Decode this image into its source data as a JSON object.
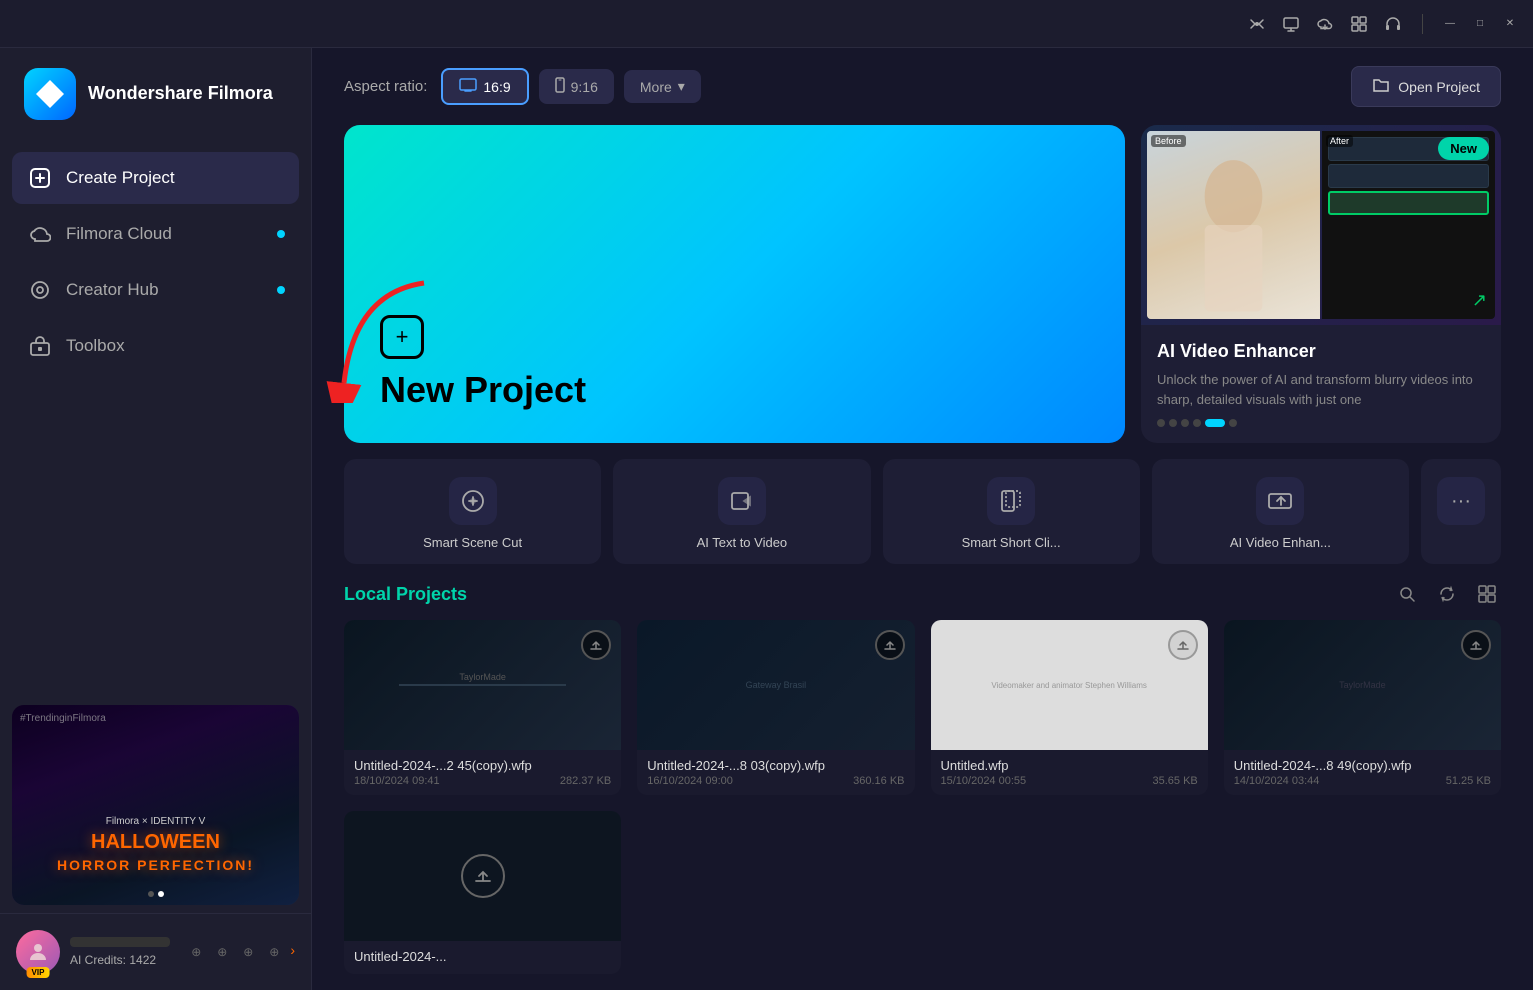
{
  "app": {
    "name": "Wondershare Filmora"
  },
  "titlebar": {
    "icons": [
      "broadcast",
      "screen",
      "download",
      "grid",
      "headphones"
    ],
    "minimize": "—",
    "maximize": "□",
    "close": "✕"
  },
  "sidebar": {
    "nav_items": [
      {
        "id": "create-project",
        "label": "Create Project",
        "icon": "➕",
        "active": true,
        "dot": false
      },
      {
        "id": "filmora-cloud",
        "label": "Filmora Cloud",
        "icon": "☁",
        "active": false,
        "dot": true
      },
      {
        "id": "creator-hub",
        "label": "Creator Hub",
        "icon": "◎",
        "active": false,
        "dot": true
      },
      {
        "id": "toolbox",
        "label": "Toolbox",
        "icon": "🗃",
        "active": false,
        "dot": false
      }
    ],
    "user": {
      "credits_label": "AI Credits: 1422",
      "vip": "VIP"
    }
  },
  "topbar": {
    "aspect_ratio_label": "Aspect ratio:",
    "aspect_16_9": "16:9",
    "aspect_9_16": "9:16",
    "more_label": "More",
    "open_project_label": "Open Project"
  },
  "new_project": {
    "title": "New Project"
  },
  "ai_card": {
    "badge": "New",
    "title": "AI Video Enhancer",
    "description": "Unlock the power of AI and transform blurry videos into sharp, detailed visuals with just one",
    "dots": [
      false,
      false,
      false,
      false,
      true,
      false
    ]
  },
  "quick_actions": [
    {
      "id": "smart-scene-cut",
      "label": "Smart Scene Cut",
      "icon": "📹"
    },
    {
      "id": "ai-text-to-video",
      "label": "AI Text to Video",
      "icon": "📲"
    },
    {
      "id": "smart-short-cli",
      "label": "Smart Short Cli...",
      "icon": "📱"
    },
    {
      "id": "ai-video-enhan",
      "label": "AI Video Enhan...",
      "icon": "🎬"
    },
    {
      "id": "more",
      "label": "···",
      "icon": "···"
    }
  ],
  "local_projects": {
    "title": "Local Projects",
    "items": [
      {
        "name": "Untitled-2024-...2 45(copy).wfp",
        "date": "18/10/2024 09:41",
        "size": "282.37 KB"
      },
      {
        "name": "Untitled-2024-...8 03(copy).wfp",
        "date": "16/10/2024 09:00",
        "size": "360.16 KB"
      },
      {
        "name": "Untitled.wfp",
        "date": "15/10/2024 00:55",
        "size": "35.65 KB"
      },
      {
        "name": "Untitled-2024-...8 49(copy).wfp",
        "date": "14/10/2024 03:44",
        "size": "51.25 KB"
      },
      {
        "name": "Untitled-2024-...",
        "date": "",
        "size": ""
      }
    ]
  }
}
